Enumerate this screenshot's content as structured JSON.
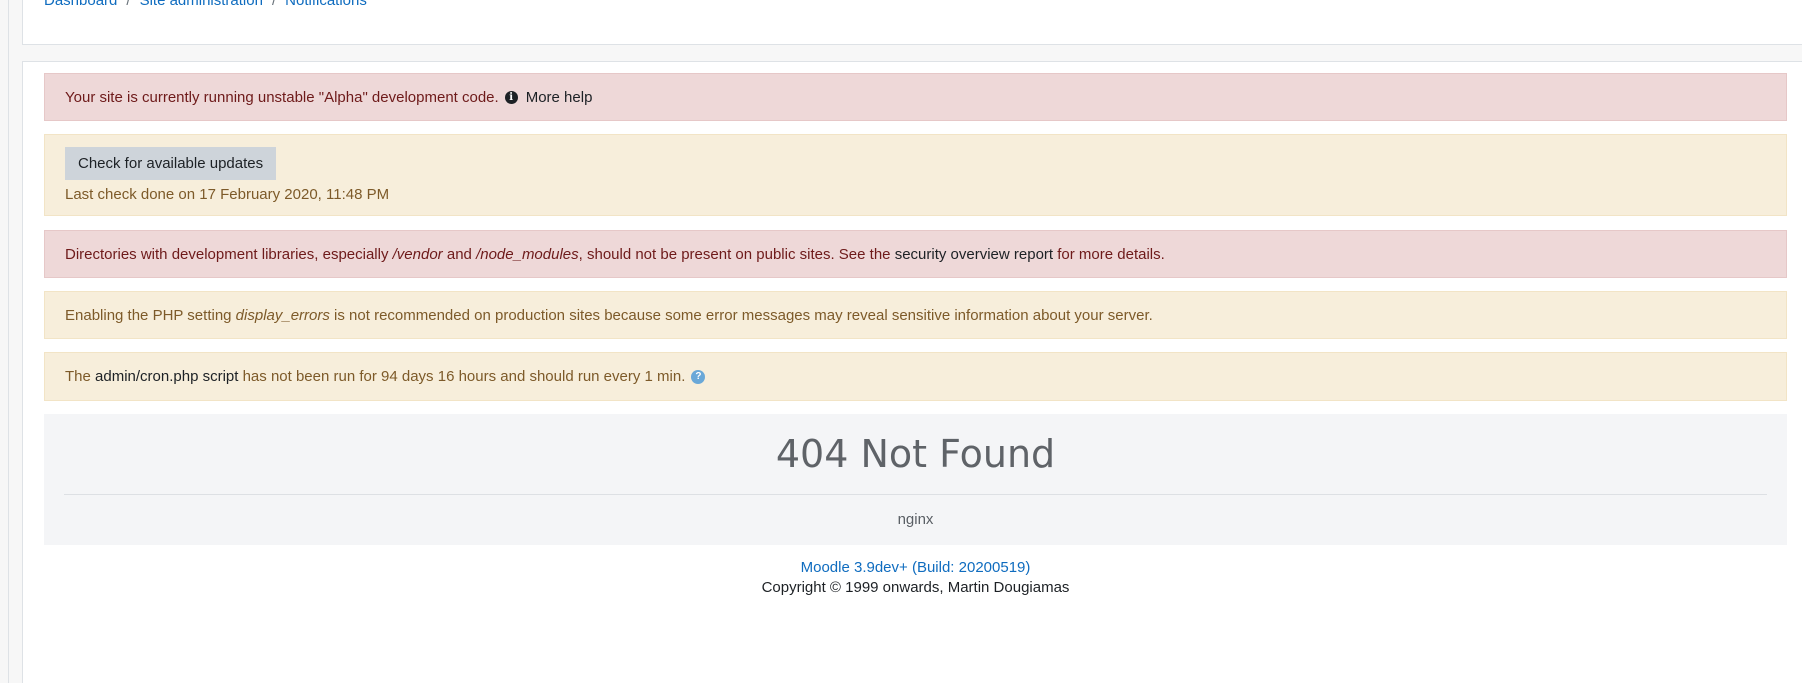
{
  "breadcrumb": {
    "items": [
      "Dashboard",
      "Site administration",
      "Notifications"
    ],
    "separator": "/"
  },
  "alerts": {
    "alpha": {
      "text": "Your site is currently running unstable \"Alpha\" development code.",
      "icon": "info-circle-icon",
      "help_link": "More help"
    },
    "updates": {
      "button_label": "Check for available updates",
      "last_check": "Last check done on 17 February 2020, 11:48 PM"
    },
    "dev_libraries": {
      "text_1": "Directories with development libraries, especially ",
      "vendor": "/vendor",
      "and": " and ",
      "node_modules": "/node_modules",
      "text_2": ", should not be present on public sites. See the ",
      "link": "security overview report",
      "text_3": " for more details."
    },
    "display_errors": {
      "text_1": "Enabling the PHP setting ",
      "setting": "display_errors",
      "text_2": " is not recommended on production sites because some error messages may reveal sensitive information about your server."
    },
    "cron": {
      "text_1": "The ",
      "link": "admin/cron.php script",
      "text_2": " has not been run for 94 days 16 hours and should run every 1 min.",
      "icon": "question-circle-icon",
      "icon_glyph": "?"
    }
  },
  "not_found": {
    "title": "404 Not Found",
    "server": "nginx"
  },
  "footer": {
    "version": "Moodle 3.9dev+ (Build: 20200519)",
    "copyright": "Copyright © 1999 onwards, Martin Dougiamas"
  },
  "colors": {
    "link": "#0f6cbf",
    "danger_bg": "#eed8d8",
    "warning_bg": "#f7eedb"
  }
}
